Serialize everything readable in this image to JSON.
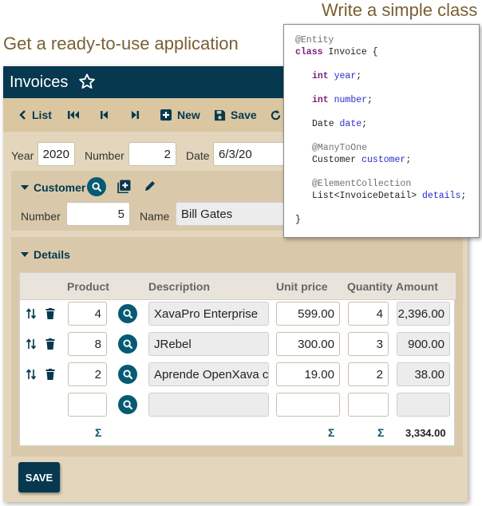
{
  "headings": {
    "left": "Get a ready-to-use application",
    "right": "Write a simple class"
  },
  "app": {
    "title": "Invoices",
    "toolbar": {
      "list": "List",
      "new": "New",
      "save": "Save"
    },
    "fields": {
      "year_label": "Year",
      "year_value": "2020",
      "number_label": "Number",
      "number_value": "2",
      "date_label": "Date",
      "date_value": "6/3/20"
    },
    "customer": {
      "section_label": "Customer",
      "number_label": "Number",
      "number_value": "5",
      "name_label": "Name",
      "name_value": "Bill Gates"
    },
    "details": {
      "section_label": "Details",
      "columns": [
        "Product",
        "Description",
        "Unit price",
        "Quantity",
        "Amount"
      ],
      "rows": [
        {
          "product": "4",
          "description": "XavaPro Enterprise",
          "unit_price": "599.00",
          "quantity": "4",
          "amount": "2,396.00"
        },
        {
          "product": "8",
          "description": "JRebel",
          "unit_price": "300.00",
          "quantity": "3",
          "amount": "900.00"
        },
        {
          "product": "2",
          "description": "Aprende OpenXava co",
          "unit_price": "19.00",
          "quantity": "2",
          "amount": "38.00"
        },
        {
          "product": "",
          "description": "",
          "unit_price": "",
          "quantity": "",
          "amount": ""
        }
      ],
      "sigma": "Σ",
      "total": "3,334.00"
    },
    "save_button": "SAVE"
  },
  "code": {
    "l1": "@Entity",
    "l2_kw": "class",
    "l2_rest": " Invoice {",
    "l3_kw": "int",
    "l3_fld": "year",
    "l4_kw": "int",
    "l4_fld": "number",
    "l5_type": "Date",
    "l5_fld": "date",
    "l6": "@ManyToOne",
    "l7_type": "Customer",
    "l7_fld": "customer",
    "l8": "@ElementCollection",
    "l9_type": "List<InvoiceDetail>",
    "l9_fld": "details",
    "l10": "}"
  },
  "colors": {
    "title_bar": "#06384f",
    "toolbar": "#dac7a1",
    "panel": "#e4d6bc",
    "accent": "#075a73",
    "heading_text": "#7a6034"
  }
}
